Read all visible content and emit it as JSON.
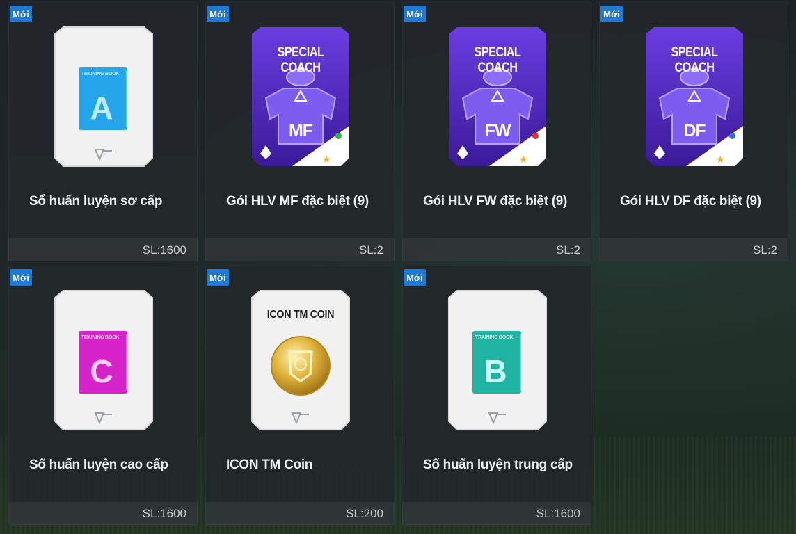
{
  "new_badge": "Mới",
  "items": [
    {
      "title": "Sổ huấn luyện sơ cấp",
      "qty": "SL:1600",
      "type": "book",
      "book_letter": "A",
      "book_caption": "TRAINING BOOK",
      "book_color": "#26a6ea"
    },
    {
      "title": "Gói HLV MF đặc biệt (9)",
      "qty": "SL:2",
      "type": "coach",
      "coach_label": "SPECIAL COACH",
      "position": "MF",
      "rating": "9",
      "dot_color": "#2db24a"
    },
    {
      "title": "Gói HLV FW đặc biệt (9)",
      "qty": "SL:2",
      "type": "coach",
      "coach_label": "SPECIAL COACH",
      "position": "FW",
      "rating": "9",
      "dot_color": "#e0322f"
    },
    {
      "title": "Gói HLV DF đặc biệt (9)",
      "qty": "SL:2",
      "type": "coach",
      "coach_label": "SPECIAL COACH",
      "position": "DF",
      "rating": "9",
      "dot_color": "#2f6fe0"
    },
    {
      "title": "Sổ huấn luyện cao cấp",
      "qty": "SL:1600",
      "type": "book",
      "book_letter": "C",
      "book_caption": "TRAINING BOOK",
      "book_color": "#d523c9"
    },
    {
      "title": "ICON TM Coin",
      "qty": "SL:200",
      "type": "coin",
      "coin_label": "ICON TM COIN"
    },
    {
      "title": "Sổ huấn luyện trung cấp",
      "qty": "SL:1600",
      "type": "book",
      "book_letter": "B",
      "book_caption": "TRAINING BOOK",
      "book_color": "#1fb3a2"
    }
  ],
  "colors": {
    "badge": "#1f7ad6",
    "coach_card": "#5b2fc8",
    "rating_star": "#f2a81d"
  }
}
